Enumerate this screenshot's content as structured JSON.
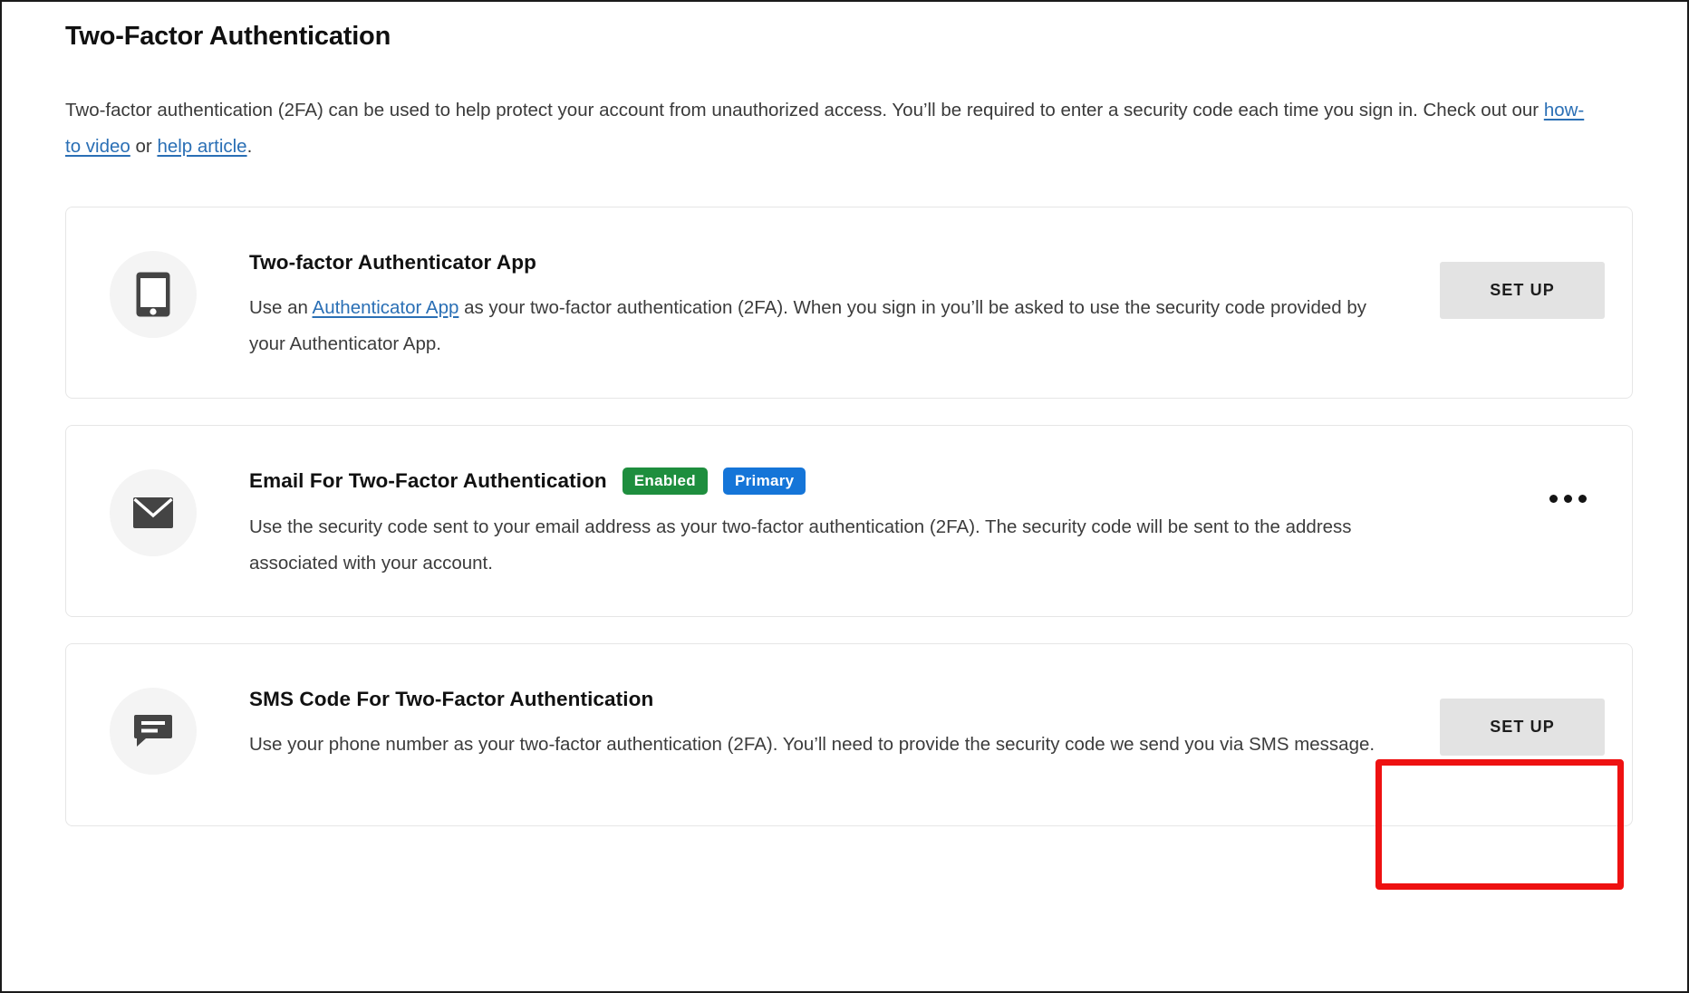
{
  "page": {
    "title": "Two-Factor Authentication",
    "intro": {
      "text_part_1": "Two-factor authentication (2FA) can be used to help protect your account from unauthorized access. You’ll be required to enter a security code each time you sign in. Check out our ",
      "link_1": "how-to video",
      "text_part_2": " or ",
      "link_2": "help article",
      "text_part_3": "."
    }
  },
  "cards": [
    {
      "icon": "mobile-device-icon",
      "title": "Two-factor Authenticator App",
      "desc_part_1": "Use an ",
      "desc_link": "Authenticator App",
      "desc_part_2": " as your two-factor authentication (2FA). When you sign in you’ll be asked to use the security code provided by your Authenticator App.",
      "action_label": "SET UP"
    },
    {
      "icon": "envelope-icon",
      "title": "Email For Two-Factor Authentication",
      "badges": [
        {
          "label": "Enabled",
          "color": "#1e8e3e"
        },
        {
          "label": "Primary",
          "color": "#1575d8"
        }
      ],
      "desc": "Use the security code sent to your email address as your two-factor authentication (2FA). The security code will be sent to the address associated with your account.",
      "action": "overflow-menu"
    },
    {
      "icon": "chat-bubble-icon",
      "title": "SMS Code For Two-Factor Authentication",
      "desc": "Use your phone number as your two-factor authentication (2FA). You’ll need to provide the security code we send you via SMS message.",
      "action_label": "SET UP",
      "highlighted": true
    }
  ],
  "annotation": {
    "color": "#ee1111",
    "target": "sms-set-up-button"
  }
}
